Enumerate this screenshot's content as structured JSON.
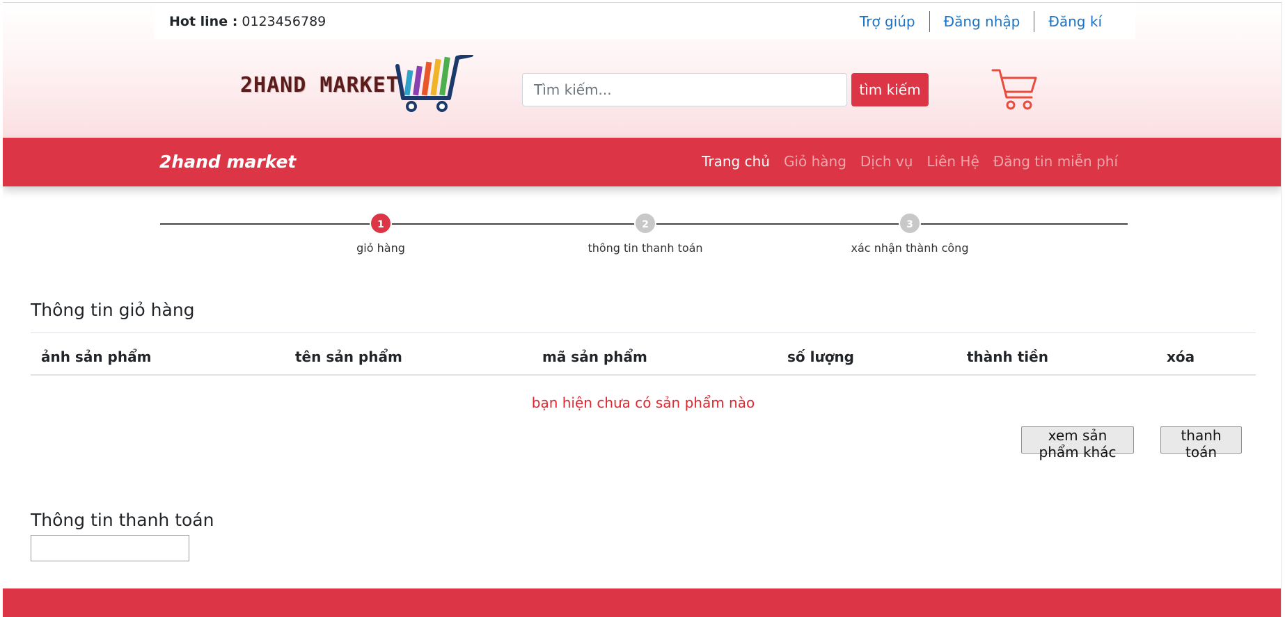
{
  "topbar": {
    "hotline_label": "Hot line :",
    "hotline_number": "0123456789",
    "links": [
      "Trợ giúp",
      "Đăng nhập",
      "Đăng kí"
    ]
  },
  "logo": {
    "text": "2HAND MARKET"
  },
  "search": {
    "placeholder": "Tìm kiếm...",
    "button_label": "tìm kiếm"
  },
  "icons": {
    "cart": "shopping-cart-icon"
  },
  "navbar": {
    "brand": "2hand market",
    "items": [
      "Trang chủ",
      "Giỏ hàng",
      "Dịch vụ",
      "Liên Hệ",
      "Đăng tin miễn phí"
    ],
    "active_index": 0
  },
  "steps": [
    {
      "number": "1",
      "label": "giỏ hàng",
      "active": true
    },
    {
      "number": "2",
      "label": "thông tin thanh toán",
      "active": false
    },
    {
      "number": "3",
      "label": "xác nhận thành công",
      "active": false
    }
  ],
  "cart_section": {
    "title": "Thông tin giỏ hàng",
    "columns": [
      "ảnh sản phẩm",
      "tên sản phẩm",
      "mã sản phẩm",
      "số lượng",
      "thành tiền",
      "xóa"
    ],
    "empty_message": "bạn hiện chưa có sản phẩm nào",
    "buttons": {
      "more": "xem sản phẩm khác",
      "checkout": "thanh toán"
    }
  },
  "payment_section": {
    "title": "Thông tin thanh toán"
  },
  "colors": {
    "primary": "#dc3545",
    "link": "#1a73c7",
    "empty_text": "#e0262f"
  }
}
